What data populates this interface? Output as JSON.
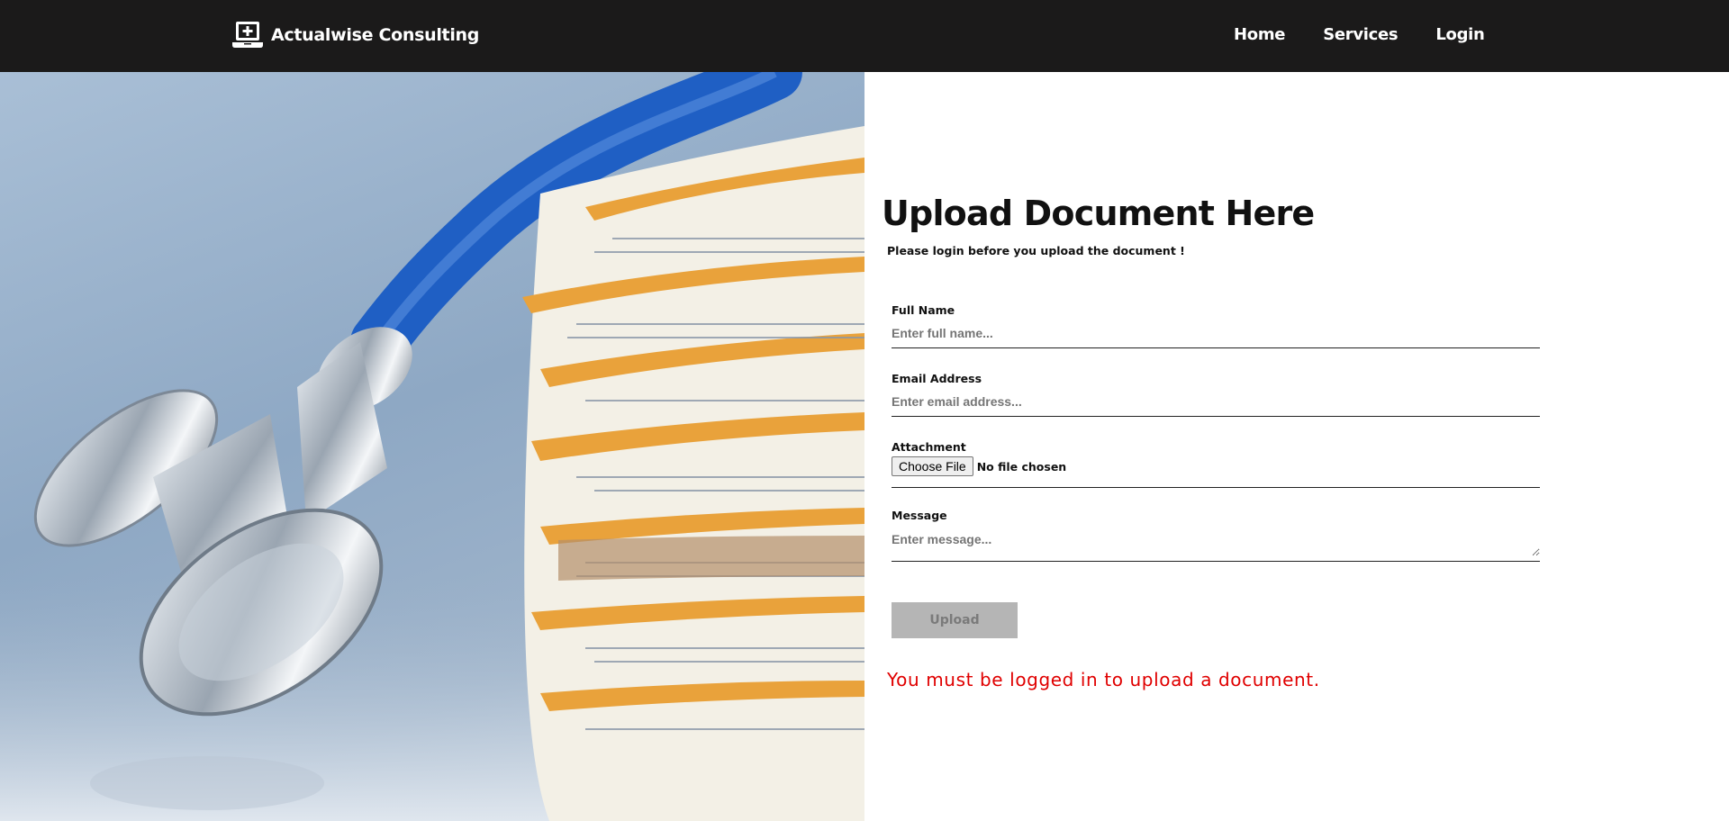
{
  "header": {
    "brand_name": "Actualwise Consulting",
    "brand_icon": "laptop-medical-icon",
    "nav": [
      {
        "label": "Home"
      },
      {
        "label": "Services"
      },
      {
        "label": "Login"
      }
    ]
  },
  "hero": {
    "image": "stethoscope-on-stack-of-file-folders"
  },
  "form": {
    "title": "Upload Document Here",
    "subtitle": "Please login before you upload the document !",
    "full_name": {
      "label": "Full Name",
      "placeholder": "Enter full name...",
      "value": ""
    },
    "email": {
      "label": "Email Address",
      "placeholder": "Enter email address...",
      "value": ""
    },
    "attachment": {
      "label": "Attachment",
      "button_label": "Choose File",
      "status": "No file chosen"
    },
    "message": {
      "label": "Message",
      "placeholder": "Enter message...",
      "value": ""
    },
    "submit_label": "Upload",
    "error_text": "You must be logged in to upload a document."
  },
  "colors": {
    "navbar_bg": "#1b1a1a",
    "error": "#e00000",
    "button_disabled_bg": "#b5b5b5",
    "stethoscope_tube": "#1f5fc4",
    "folder_orange": "#e9a23b"
  }
}
